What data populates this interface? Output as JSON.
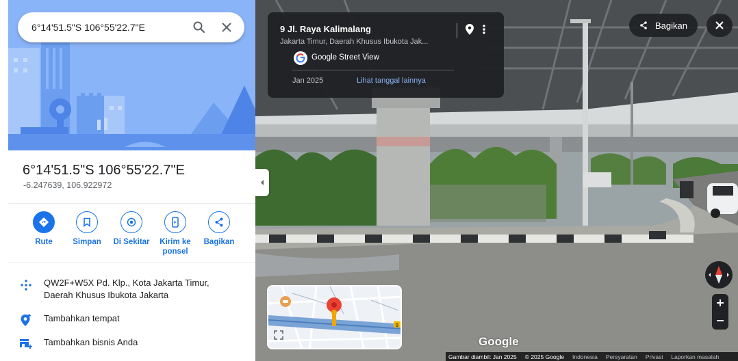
{
  "search": {
    "value": "6°14'51.5\"S 106°55'22.7\"E"
  },
  "place": {
    "title": "6°14'51.5\"S 106°55'22.7\"E",
    "coords": "-6.247639, 106.922972"
  },
  "actions": [
    {
      "label": "Rute",
      "icon": "directions-icon"
    },
    {
      "label": "Simpan",
      "icon": "bookmark-icon"
    },
    {
      "label": "Di Sekitar",
      "icon": "nearby-icon"
    },
    {
      "label": "Kirim ke ponsel",
      "icon": "send-to-phone-icon"
    },
    {
      "label": "Bagikan",
      "icon": "share-icon"
    }
  ],
  "info": {
    "plus_code": "QW2F+W5X Pd. Klp., Kota Jakarta Timur, Daerah Khusus Ibukota Jakarta",
    "add_place": "Tambahkan tempat",
    "add_business": "Tambahkan bisnis Anda"
  },
  "street_view": {
    "address": "9 Jl. Raya Kalimalang",
    "region": "Jakarta Timur, Daerah Khusus Ibukota Jak...",
    "provider": "Google Street View",
    "date": "Jan 2025",
    "more_dates": "Lihat tanggal lainnya",
    "share_label": "Bagikan",
    "logo": "Google",
    "minimap_badge": "8"
  },
  "footer": {
    "captured": "Gambar diambil: Jan 2025",
    "copyright": "© 2025 Google",
    "country": "Indonesia",
    "terms": "Persyaratan",
    "privacy": "Privasi",
    "report": "Laporkan masalah"
  },
  "colors": {
    "accent": "#1a73e8",
    "hero_bg": "#8ab4f8",
    "card_bg": "#202124",
    "pin_red": "#ea4335"
  }
}
